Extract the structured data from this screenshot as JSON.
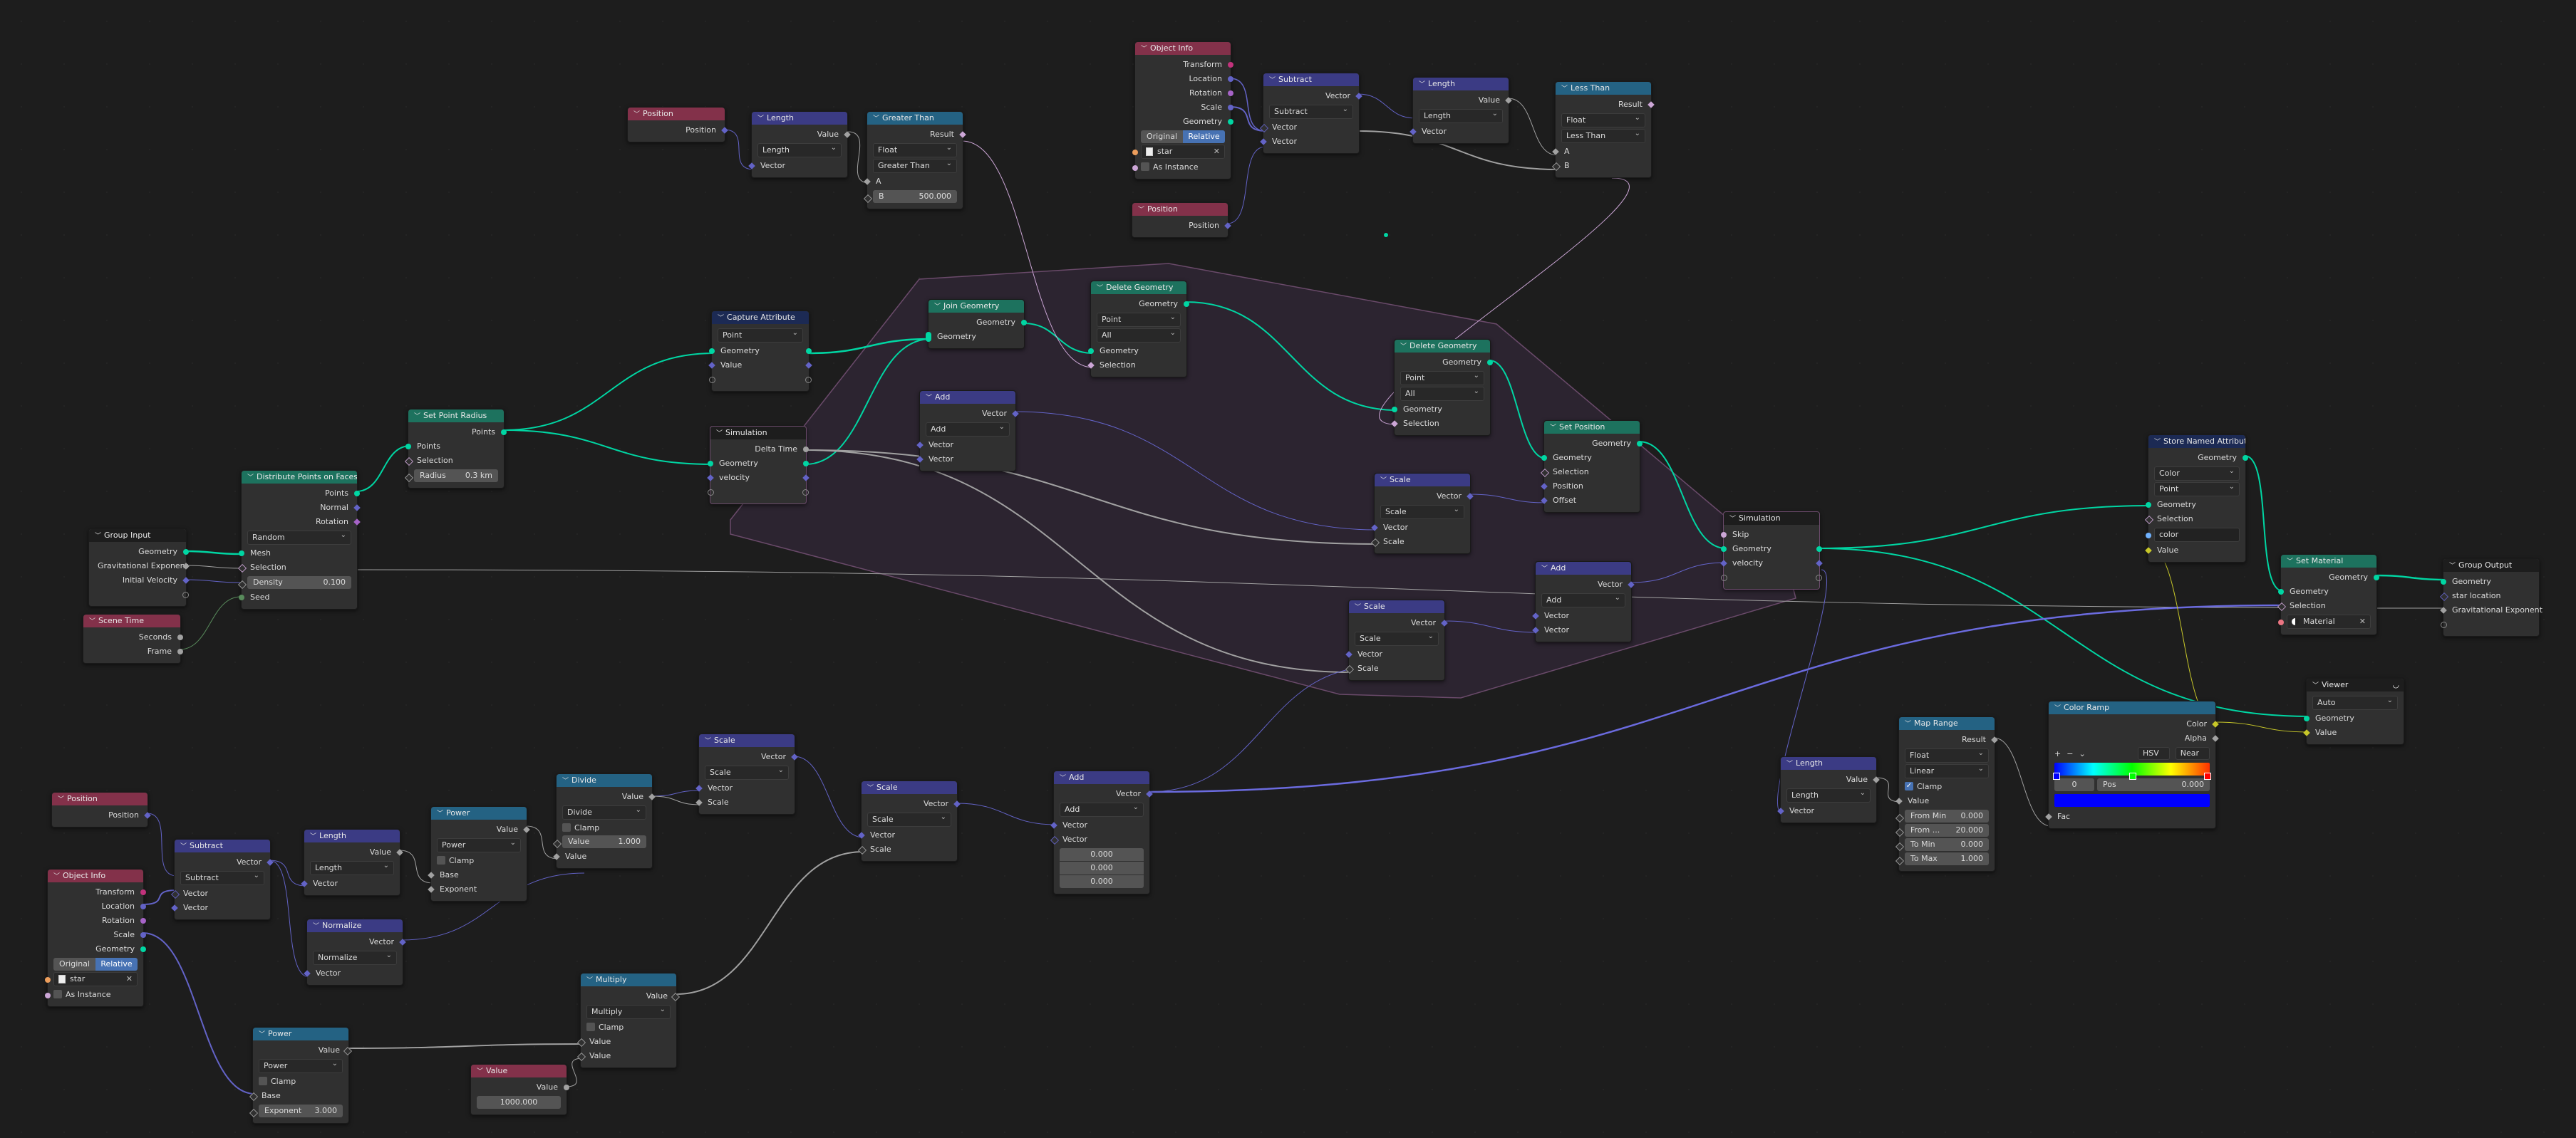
{
  "editor": {
    "type": "Geometry Node Editor"
  },
  "colors": {
    "background": "#1d1d1d",
    "geometry_socket": "#00d6a3",
    "vector_socket": "#6363c7",
    "float_socket": "#a1a1a1",
    "bool_socket": "#cca6d6",
    "color_socket": "#c7c729",
    "input_header": "#83314a",
    "vector_header": "#3b3b84",
    "converter_header": "#246283",
    "geometry_header": "#1d725e",
    "simulation_frame": "#2c2430"
  },
  "nodes": {
    "position_top": {
      "title": "Position",
      "out": [
        "Position"
      ]
    },
    "length_top": {
      "title": "Length",
      "out": [
        "Value"
      ],
      "mode": "Length",
      "in": [
        "Vector"
      ]
    },
    "greater_than": {
      "title": "Greater Than",
      "out": [
        "Result"
      ],
      "type": "Float",
      "op": "Greater Than",
      "a": "A",
      "b_label": "B",
      "b_value": "500.000"
    },
    "object_info_top": {
      "title": "Object Info",
      "out": [
        "Transform",
        "Location",
        "Rotation",
        "Scale",
        "Geometry"
      ],
      "seg": [
        "Original",
        "Relative"
      ],
      "seg_active": "Relative",
      "object": "star",
      "as_instance": "As Instance"
    },
    "position_top2": {
      "title": "Position",
      "out": [
        "Position"
      ]
    },
    "subtract_top": {
      "title": "Subtract",
      "out": [
        "Vector"
      ],
      "op": "Subtract",
      "in": [
        "Vector",
        "Vector"
      ]
    },
    "length_top2": {
      "title": "Length",
      "out": [
        "Value"
      ],
      "mode": "Length",
      "in": [
        "Vector"
      ]
    },
    "less_than": {
      "title": "Less Than",
      "out": [
        "Result"
      ],
      "type": "Float",
      "op": "Less Than",
      "in": [
        "A",
        "B"
      ]
    },
    "group_input": {
      "title": "Group Input",
      "out": [
        "Geometry",
        "Gravitational Exponent",
        "Initial Velocity"
      ]
    },
    "scene_time": {
      "title": "Scene Time",
      "out": [
        "Seconds",
        "Frame"
      ]
    },
    "distribute": {
      "title": "Distribute Points on Faces",
      "out": [
        "Points",
        "Normal",
        "Rotation"
      ],
      "mode": "Random",
      "in": [
        "Mesh",
        "Selection"
      ],
      "density_label": "Density",
      "density_value": "0.100",
      "seed": "Seed"
    },
    "set_point_radius": {
      "title": "Set Point Radius",
      "out": [
        "Points"
      ],
      "in": [
        "Points",
        "Selection"
      ],
      "radius_label": "Radius",
      "radius_value": "0.3 km"
    },
    "capture_attribute": {
      "title": "Capture Attribute",
      "domain": "Point",
      "rows": [
        "Geometry",
        "Value"
      ]
    },
    "sim_input": {
      "title": "Simulation",
      "out": [
        "Delta Time"
      ],
      "rows": [
        "Geometry",
        "velocity"
      ]
    },
    "join_geometry": {
      "title": "Join Geometry",
      "out": [
        "Geometry"
      ],
      "in": [
        "Geometry"
      ]
    },
    "delete_geo_1": {
      "title": "Delete Geometry",
      "out": [
        "Geometry"
      ],
      "domain": "Point",
      "mode": "All",
      "in": [
        "Geometry",
        "Selection"
      ]
    },
    "add_mid": {
      "title": "Add",
      "out": [
        "Vector"
      ],
      "op": "Add",
      "in": [
        "Vector",
        "Vector"
      ]
    },
    "delete_geo_2": {
      "title": "Delete Geometry",
      "out": [
        "Geometry"
      ],
      "domain": "Point",
      "mode": "All",
      "in": [
        "Geometry",
        "Selection"
      ]
    },
    "set_position": {
      "title": "Set Position",
      "out": [
        "Geometry"
      ],
      "in": [
        "Geometry",
        "Selection",
        "Position",
        "Offset"
      ]
    },
    "scale_mid": {
      "title": "Scale",
      "out": [
        "Vector"
      ],
      "op": "Scale",
      "in": [
        "Vector",
        "Scale"
      ]
    },
    "add_right": {
      "title": "Add",
      "out": [
        "Vector"
      ],
      "op": "Add",
      "in": [
        "Vector",
        "Vector"
      ]
    },
    "scale_low": {
      "title": "Scale",
      "out": [
        "Vector"
      ],
      "op": "Scale",
      "in": [
        "Vector",
        "Scale"
      ]
    },
    "sim_output": {
      "title": "Simulation",
      "in": [
        "Skip"
      ],
      "rows": [
        "Geometry",
        "velocity"
      ]
    },
    "store_named": {
      "title": "Store Named Attribute",
      "out": [
        "Geometry"
      ],
      "type": "Color",
      "domain": "Point",
      "in": [
        "Geometry",
        "Selection"
      ],
      "name": "color",
      "value": "Value"
    },
    "set_material": {
      "title": "Set Material",
      "out": [
        "Geometry"
      ],
      "in": [
        "Geometry",
        "Selection"
      ],
      "material": "Material"
    },
    "group_output": {
      "title": "Group Output",
      "in": [
        "Geometry",
        "star location",
        "Gravitational Exponent"
      ]
    },
    "viewer": {
      "title": "Viewer",
      "domain": "Auto",
      "in": [
        "Geometry",
        "Value"
      ]
    },
    "color_ramp": {
      "title": "Color Ramp",
      "out": [
        "Color",
        "Alpha"
      ],
      "color_mode": "HSV",
      "interp": "Near",
      "index": "0",
      "pos_label": "Pos",
      "pos_value": "0.000",
      "in": [
        "Fac"
      ],
      "tools": [
        "+",
        "−",
        "⌄"
      ]
    },
    "map_range": {
      "title": "Map Range",
      "out": [
        "Result"
      ],
      "type": "Float",
      "interp": "Linear",
      "clamp": "Clamp",
      "in": [
        "Value"
      ],
      "fields": [
        {
          "label": "From Min",
          "value": "0.000"
        },
        {
          "label": "From ...",
          "value": "20.000"
        },
        {
          "label": "To Min",
          "value": "0.000"
        },
        {
          "label": "To Max",
          "value": "1.000"
        }
      ]
    },
    "length_right": {
      "title": "Length",
      "out": [
        "Value"
      ],
      "mode": "Length",
      "in": [
        "Vector"
      ]
    },
    "position_bot": {
      "title": "Position",
      "out": [
        "Position"
      ]
    },
    "object_info_bot": {
      "title": "Object Info",
      "out": [
        "Transform",
        "Location",
        "Rotation",
        "Scale",
        "Geometry"
      ],
      "seg": [
        "Original",
        "Relative"
      ],
      "seg_active": "Relative",
      "object": "star",
      "as_instance": "As Instance"
    },
    "subtract_bot": {
      "title": "Subtract",
      "out": [
        "Vector"
      ],
      "op": "Subtract",
      "in": [
        "Vector",
        "Vector"
      ]
    },
    "length_bot": {
      "title": "Length",
      "out": [
        "Value"
      ],
      "mode": "Length",
      "in": [
        "Vector"
      ]
    },
    "normalize": {
      "title": "Normalize",
      "out": [
        "Vector"
      ],
      "op": "Normalize",
      "in": [
        "Vector"
      ]
    },
    "power_top": {
      "title": "Power",
      "out": [
        "Value"
      ],
      "op": "Power",
      "clamp": "Clamp",
      "in": [
        "Base",
        "Exponent"
      ]
    },
    "divide": {
      "title": "Divide",
      "out": [
        "Value"
      ],
      "op": "Divide",
      "clamp": "Clamp",
      "v_label": "Value",
      "v_value": "1.000",
      "in": [
        "Value"
      ]
    },
    "scale_bot1": {
      "title": "Scale",
      "out": [
        "Vector"
      ],
      "op": "Scale",
      "in": [
        "Vector",
        "Scale"
      ]
    },
    "scale_bot2": {
      "title": "Scale",
      "out": [
        "Vector"
      ],
      "op": "Scale",
      "in": [
        "Vector",
        "Scale"
      ]
    },
    "add_bot": {
      "title": "Add",
      "out": [
        "Vector"
      ],
      "op": "Add",
      "in": [
        "Vector",
        "Vector"
      ],
      "xyz": [
        "0.000",
        "0.000",
        "0.000"
      ]
    },
    "multiply": {
      "title": "Multiply",
      "out": [
        "Value"
      ],
      "op": "Multiply",
      "clamp": "Clamp",
      "in": [
        "Value",
        "Value"
      ]
    },
    "power_bot": {
      "title": "Power",
      "out": [
        "Value"
      ],
      "op": "Power",
      "clamp": "Clamp",
      "in": [
        "Base"
      ],
      "exp_label": "Exponent",
      "exp_value": "3.000"
    },
    "value_node": {
      "title": "Value",
      "out": [
        "Value"
      ],
      "value": "1000.000"
    }
  }
}
